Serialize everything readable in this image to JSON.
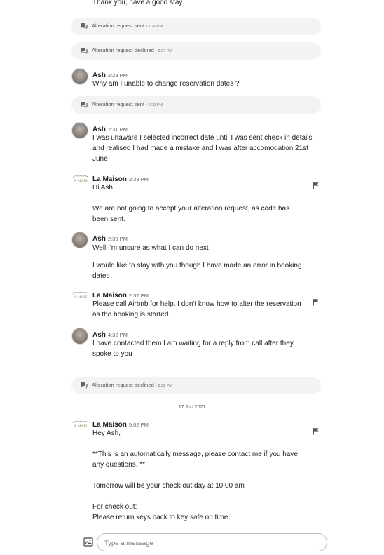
{
  "messages": {
    "m0": {
      "text": "Thank you, have a good stay."
    },
    "e1": {
      "label": "Alteration request sent",
      "time": "• 2:26 PM"
    },
    "e2": {
      "label": "Alteration request declined",
      "time": "• 2:27 PM"
    },
    "m1": {
      "name": "Ash",
      "time": "2:28 PM",
      "lines": [
        "Why am I unable to change reservation dates ?"
      ]
    },
    "e3": {
      "label": "Alteration request sent",
      "time": "• 2:29 PM"
    },
    "m2": {
      "name": "Ash",
      "time": "2:31 PM",
      "lines": [
        "I was unaware I selected incorrect date until I was sent check in details",
        "and realised I had made a mistake and I was after accomodation 21st",
        "June"
      ]
    },
    "m3": {
      "name": "La Maison",
      "time": "2:38 PM",
      "lines": [
        "Hi Ash",
        "We are not going to accept your alteration request, as code has",
        "been sent."
      ]
    },
    "m4": {
      "name": "Ash",
      "time": "2:39 PM",
      "lines": [
        "Well I'm unsure as what I can do next",
        "I would like to stay with you though I have made an error in booking",
        "dates"
      ]
    },
    "m5": {
      "name": "La Maison",
      "time": "2:57 PM",
      "lines": [
        "Please call Airbnb for help. I don't know how to alter the reservation",
        "as the booking is started."
      ]
    },
    "m6": {
      "name": "Ash",
      "time": "4:32 PM",
      "lines": [
        "I have contacted them I am waiting for a reply from call after they",
        "spoke to you"
      ]
    },
    "e4": {
      "label": "Alteration request declined",
      "time": "• 6:22 PM"
    },
    "m7": {
      "name": "La Maison",
      "time": "5:02 PM",
      "lines": [
        "Hey Ash,",
        "**This is an automatically message, please contact me if you have",
        "any questions. **",
        "Tomorrow will be your check out day at 10:00 am",
        "For check out:",
        "Please return keys back to key safe on time."
      ]
    }
  },
  "date_separator": "17 Jun 2021",
  "host_logo_text": "A MAIS",
  "composer": {
    "placeholder": "Type a message"
  },
  "icons": {
    "event": "chat-bubbles-icon",
    "flag": "flag-icon",
    "image": "image-icon"
  }
}
